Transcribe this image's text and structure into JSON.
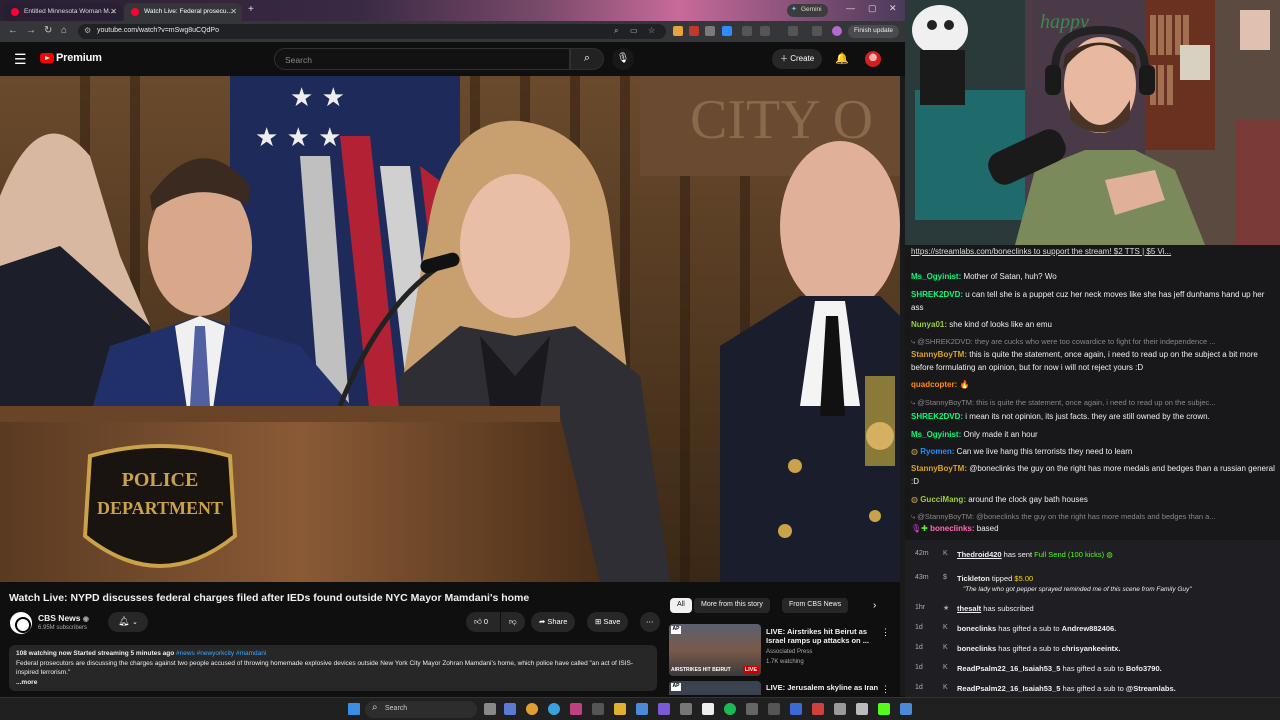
{
  "browser": {
    "tabs": [
      {
        "title": "Entitled Minnesota Woman M..."
      },
      {
        "title": "Watch Live: Federal prosecu..."
      }
    ],
    "gemini_label": "Gemini",
    "url": "youtube.com/watch?v=mSwg8uCQdPo",
    "finish_update": "Finish update"
  },
  "youtube": {
    "brand": "Premium",
    "search_placeholder": "Search",
    "create_label": "Create",
    "video_title": "Watch Live: NYPD discusses federal charges filed after IEDs found outside NYC Mayor Mamdani's home",
    "channel": {
      "name": "CBS News",
      "subscribers": "6.95M subscribers"
    },
    "actions": {
      "likes": "0",
      "share": "Share",
      "save": "Save"
    },
    "description": {
      "meta": "108 watching now  Started streaming 5 minutes ago",
      "tags": "#news #newyorkcity #mamdani",
      "text": "Federal prosecutors are discussing the charges against two people accused of throwing homemade explosive devices outside New York City Mayor Zohran Mamdani's home, which police have called \"an act of ISIS-inspired terrorism.\"",
      "more": "...more"
    },
    "chips": [
      "All",
      "More from this story",
      "From CBS News"
    ],
    "related": [
      {
        "title_line1": "LIVE: Airstrikes hit Beirut as",
        "title_line2": "Israel ramps up attacks on ...",
        "channel": "Associated Press",
        "meta": "1.7K watching",
        "badge": "LIVE",
        "tag": "AP",
        "thumb_text": "AIRSTRIKES HIT BEIRUT"
      },
      {
        "title_line1": "LIVE: Jerusalem skyline as Iran",
        "tag": "AP"
      }
    ]
  },
  "video_scene": {
    "wall_text": "CITY O",
    "podium_seal_line1": "POLICE",
    "podium_seal_line2": "DEPARTMENT"
  },
  "webcam": {
    "banner_text": "happy"
  },
  "chat": {
    "pinned": "https://streamlabs.com/boneclinks to support the stream! $2 TTS | $5 Vi...",
    "messages": [
      {
        "user": "Ms_Ogyinist:",
        "text": " Mother of Satan, huh? Wo",
        "color": "#00ff7f"
      },
      {
        "user": "SHREK2DVD:",
        "text": " u can tell she is a puppet cuz her neck moves like she has jeff dunhams hand up her ass",
        "color": "#00ff7f"
      },
      {
        "user": "Nunya01:",
        "text": " she kind of looks like an emu",
        "color": "#9acd32"
      },
      {
        "reply": "@SHREK2DVD: they are cucks who were too cowardice to fight for their independence ..."
      },
      {
        "user": "StannyBoyTM:",
        "text": " this is quite the statement, once again, i need to read up on the subject a bit more before formulating an opinion, but for now i will not reject yours :D",
        "color": "#daa520"
      },
      {
        "user": "quadcopter:",
        "text": " 🔥",
        "color": "#ff8c00"
      },
      {
        "reply": "@StannyBoyTM: this is quite the statement, once again, i need to read up on the subjec..."
      },
      {
        "user": "SHREK2DVD:",
        "text": " i mean its not opinion, its just facts. they are still owned by the crown.",
        "color": "#00ff7f"
      },
      {
        "user": "Ms_Ogyinist:",
        "text": " Only made it an hour",
        "color": "#00ff7f"
      },
      {
        "user": "Ryomen:",
        "text": " Can we live hang this terrorists they need to learn",
        "color": "#1e90ff"
      },
      {
        "user": "StannyBoyTM:",
        "text": " @boneclinks the guy on the right has more medals and bedges than a russian general :D",
        "color": "#daa520"
      },
      {
        "user": "GucciMang:",
        "text": " around the clock gay bath houses",
        "color": "#9acd32"
      },
      {
        "reply": "@StannyBoyTM: @boneclinks the guy on the right has more medals and bedges than a..."
      },
      {
        "user": "boneclinks:",
        "text": " based",
        "color": "#ff69b4"
      }
    ]
  },
  "events": [
    {
      "time": "42m",
      "name": "Thedroid420",
      "text": " has sent ",
      "extra": "Full Send (100 kicks)",
      "extra_color": "#53fc18"
    },
    {
      "time": "43m",
      "name": "Tickleton",
      "text": " tipped ",
      "extra": "$5.00",
      "extra_color": "#ffd700",
      "sub": "\"The lady who got pepper sprayed reminded me of this scene from Family Guy\""
    },
    {
      "time": "1hr",
      "name": "thesalt",
      "text": " has subscribed"
    },
    {
      "time": "1d",
      "name": "boneclinks",
      "text": " has gifted a sub to ",
      "extra": "Andrew882406."
    },
    {
      "time": "1d",
      "name": "boneclinks",
      "text": " has gifted a sub to ",
      "extra": "chrisyankeeintx."
    },
    {
      "time": "1d",
      "name": "ReadPsalm22_16_Isaiah53_5",
      "text": " has gifted a sub to ",
      "extra": "Bofo3790."
    },
    {
      "time": "1d",
      "name": "ReadPsalm22_16_Isaiah53_5",
      "text": " has gifted a sub to ",
      "extra": "@Streamlabs."
    },
    {
      "time": "1d",
      "name": "boneclinks",
      "text": " has gifted a sub to ",
      "extra": "rsaifur989."
    }
  ],
  "taskbar": {
    "search_label": "Search"
  }
}
